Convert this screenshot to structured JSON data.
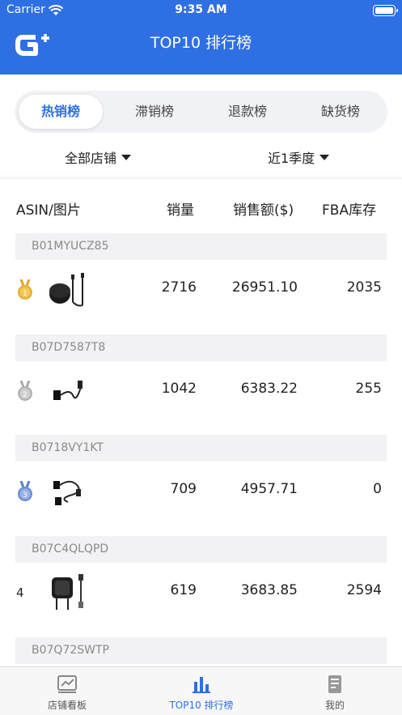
{
  "status": {
    "carrier": "Carrier",
    "time": "9:35 AM"
  },
  "header": {
    "title": "TOP10 排行榜"
  },
  "tabs": [
    {
      "label": "热销榜",
      "active": true
    },
    {
      "label": "滞销榜",
      "active": false
    },
    {
      "label": "退款榜",
      "active": false
    },
    {
      "label": "缺货榜",
      "active": false
    }
  ],
  "filters": {
    "store": "全部店铺",
    "period": "近1季度"
  },
  "table": {
    "columns": [
      "ASIN/图片",
      "销量",
      "销售额($)",
      "FBA库存"
    ],
    "rows": [
      {
        "asin": "B01MYUCZ85",
        "rank": "1",
        "sales": "2716",
        "amount": "26951.10",
        "fba": "2035"
      },
      {
        "asin": "B07D7587T8",
        "rank": "2",
        "sales": "1042",
        "amount": "6383.22",
        "fba": "255"
      },
      {
        "asin": "B0718VY1KT",
        "rank": "3",
        "sales": "709",
        "amount": "4957.71",
        "fba": "0"
      },
      {
        "asin": "B07C4QLQPD",
        "rank": "4",
        "sales": "619",
        "amount": "3683.85",
        "fba": "2594"
      },
      {
        "asin": "B07Q72SWTP"
      }
    ]
  },
  "tabbar": [
    {
      "label": "店铺看板",
      "icon": "chart-icon"
    },
    {
      "label": "TOP10 排行榜",
      "icon": "bar-chart-icon",
      "active": true
    },
    {
      "label": "我的",
      "icon": "profile-icon"
    }
  ],
  "colors": {
    "primary": "#2f6fe4",
    "gold": "#e0a526",
    "silver": "#b5b5b5",
    "bronze": "#6b8fd6"
  }
}
